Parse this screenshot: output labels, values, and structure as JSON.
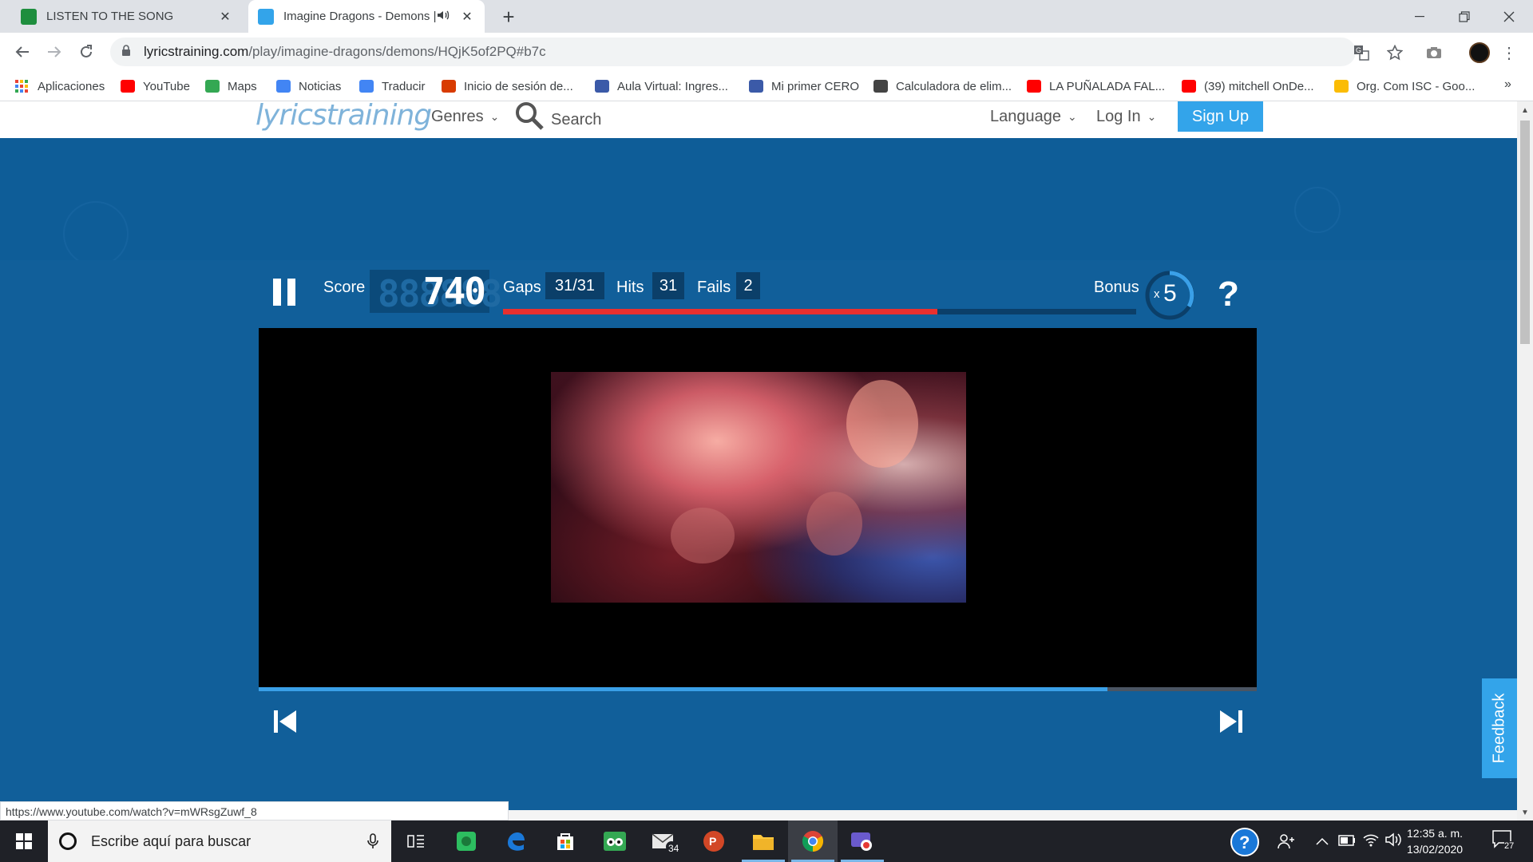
{
  "browser": {
    "tabs": [
      {
        "title": "LISTEN TO THE SONG",
        "favicon_color": "#1e8e3e",
        "active": false
      },
      {
        "title": "Imagine Dragons - Demons |",
        "favicon_color": "#33a4ea",
        "active": true
      }
    ],
    "url_host": "lyricstraining.com",
    "url_path": "/play/imagine-dragons/demons/HQjK5of2PQ#b7c",
    "bookmarks": [
      {
        "label": "Aplicaciones",
        "icon_color": "#ea4335"
      },
      {
        "label": "YouTube",
        "icon_color": "#ff0000"
      },
      {
        "label": "Maps",
        "icon_color": "#34a853"
      },
      {
        "label": "Noticias",
        "icon_color": "#4285f4"
      },
      {
        "label": "Traducir",
        "icon_color": "#4285f4"
      },
      {
        "label": "Inicio de sesión de...",
        "icon_color": "#d83b01"
      },
      {
        "label": "Aula Virtual: Ingres...",
        "icon_color": "#3b5aa8"
      },
      {
        "label": "Mi primer CERO",
        "icon_color": "#3b5aa8"
      },
      {
        "label": "Calculadora de elim...",
        "icon_color": "#444444"
      },
      {
        "label": "LA PUÑALADA FAL...",
        "icon_color": "#ff0000"
      },
      {
        "label": "(39) mitchell OnDe...",
        "icon_color": "#ff0000"
      },
      {
        "label": "Org. Com ISC - Goo...",
        "icon_color": "#fbbc04"
      }
    ],
    "more_bookmarks": "»",
    "status_url": "https://www.youtube.com/watch?v=mWRsgZuwf_8"
  },
  "site": {
    "logo": "lyricstraining",
    "nav": {
      "genres": "Genres",
      "search": "Search",
      "language": "Language",
      "login": "Log In",
      "signup": "Sign Up"
    }
  },
  "game": {
    "score_label": "Score",
    "score": "740",
    "score_ghost": "888888",
    "gaps_label": "Gaps",
    "gaps": "31/31",
    "hits_label": "Hits",
    "hits": "31",
    "fails_label": "Fails",
    "fails": "2",
    "bonus_label": "Bonus",
    "bonus_x": "x",
    "bonus_value": "5",
    "help": "?",
    "lyrics_progress": 0.686,
    "video_progress": 0.85,
    "feedback": "Feedback"
  },
  "taskbar": {
    "search_placeholder": "Escribe aquí para buscar",
    "mail_badge": "34",
    "time": "12:35 a. m.",
    "date": "13/02/2020",
    "notification_count": "27"
  },
  "colors": {
    "accent": "#33a4ea",
    "brand_blue": "#0e5d98",
    "progress_red": "#e8302f"
  }
}
